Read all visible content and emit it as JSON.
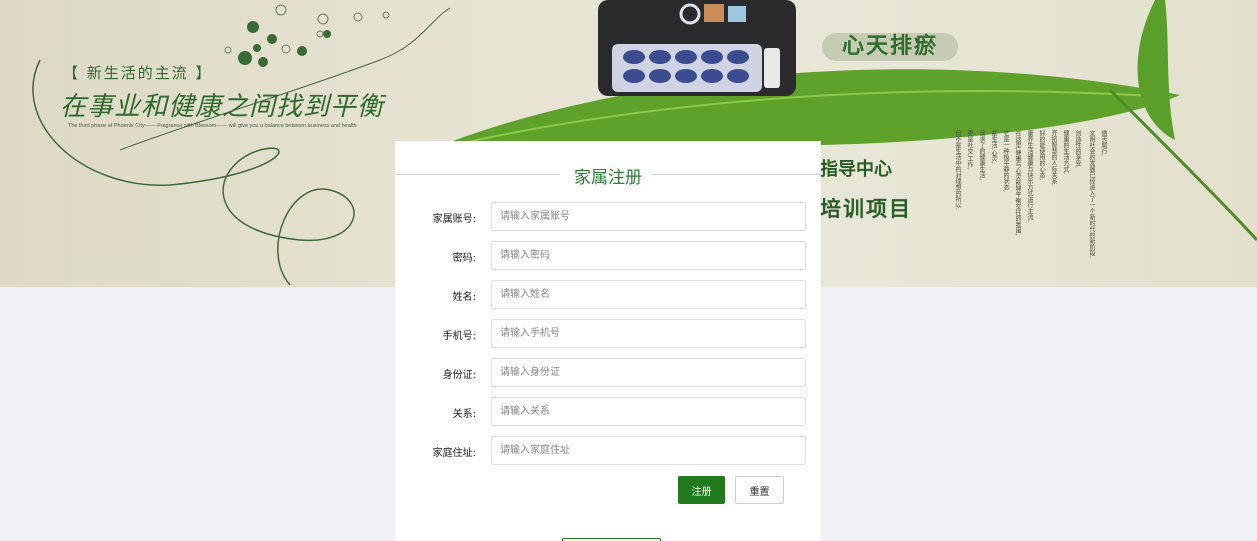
{
  "banner": {
    "slogan": "【 新生活的主流 】",
    "headline": "在事业和健康之间找到平衡",
    "english": "The third phase of Phoenix City—— Fragrance with Blossom—— will give you a balance between business and health",
    "pill_text": "心天排瘀",
    "center_text": "指导中心",
    "training_text": "培训项目",
    "vertical_lines": [
      "做天賦行,",
      "文明社会的发展已经进入了一个新时代的新阶段,",
      "创造性的享受,",
      "健康的生活方式,",
      "开拓智慧的人际关系,",
      "好的能使用的心态,",
      "康养生活健康与快乐方式进行主流,",
      "在这里,健康与心灵能够平衡交往的氛围,",
      "它是一种极平静的状态,",
      "是生活,心灵,",
      "追求了的健康生活,",
      "更是社交,工作,",
      "但不是生活中的对理想的所以,"
    ]
  },
  "form": {
    "title": "家属注册",
    "fields": [
      {
        "label": "家属账号:",
        "placeholder": "请输入家属账号"
      },
      {
        "label": "密码:",
        "placeholder": "请输入密码"
      },
      {
        "label": "姓名:",
        "placeholder": "请输入姓名"
      },
      {
        "label": "手机号:",
        "placeholder": "请输入手机号"
      },
      {
        "label": "身份证:",
        "placeholder": "请输入身份证"
      },
      {
        "label": "关系:",
        "placeholder": "请输入关系"
      },
      {
        "label": "家庭住址:",
        "placeholder": "请输入家庭住址"
      }
    ],
    "submit_label": "注册",
    "reset_label": "重置"
  },
  "colors": {
    "accent": "#217a1e",
    "title_green": "#2e7d32",
    "page_bg": "#f0f1f5"
  }
}
